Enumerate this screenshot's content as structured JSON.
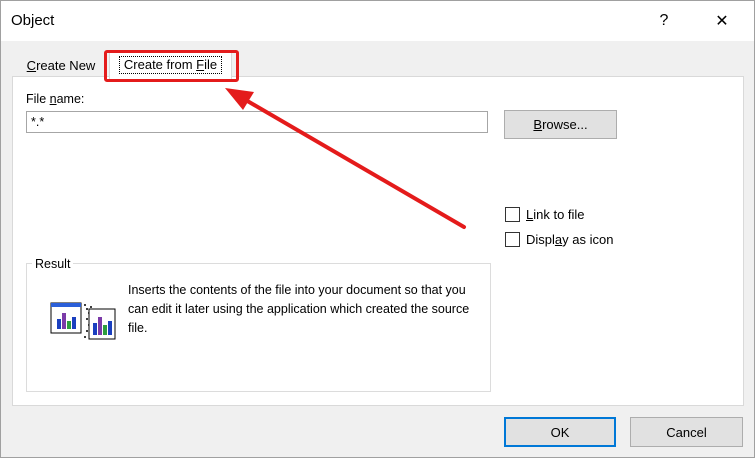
{
  "dialog": {
    "title": "Object",
    "help_label": "?",
    "close_label": "✕"
  },
  "tabs": {
    "create_new_prefix": "",
    "create_new_underlined": "C",
    "create_new_rest": "reate New",
    "create_from_file_prefix": "Create from ",
    "create_from_file_underlined": "F",
    "create_from_file_rest": "ile"
  },
  "file_section": {
    "label_prefix": "File ",
    "label_underlined": "n",
    "label_rest": "ame:",
    "value": "*.*",
    "browse_underlined": "B",
    "browse_rest": "rowse..."
  },
  "options": {
    "link_prefix": "",
    "link_underlined": "L",
    "link_rest": "ink to file",
    "display_prefix": "Displ",
    "display_underlined": "a",
    "display_rest": "y as icon",
    "link_checked": false,
    "display_checked": false
  },
  "result": {
    "legend": "Result",
    "description": "Inserts the contents of the file into your document so that you can edit it later using the application which created the source file."
  },
  "footer": {
    "ok_label": "OK",
    "cancel_label": "Cancel"
  },
  "annotation": {
    "color": "#e41b1b"
  }
}
